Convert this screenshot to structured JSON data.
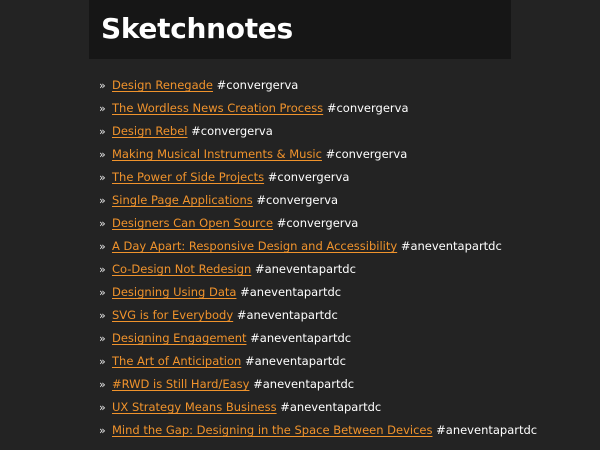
{
  "header": {
    "title": "Sketchnotes"
  },
  "items": [
    {
      "link": "Design Renegade",
      "tag": "#convergerva"
    },
    {
      "link": "The Wordless News Creation Process",
      "tag": "#convergerva"
    },
    {
      "link": "Design Rebel",
      "tag": "#convergerva"
    },
    {
      "link": "Making Musical Instruments & Music",
      "tag": "#convergerva"
    },
    {
      "link": "The Power of Side Projects",
      "tag": "#convergerva"
    },
    {
      "link": "Single Page Applications",
      "tag": "#convergerva"
    },
    {
      "link": "Designers Can Open Source",
      "tag": "#convergerva"
    },
    {
      "link": "A Day Apart: Responsive Design and Accessibility",
      "tag": "#aneventapartdc"
    },
    {
      "link": "Co-Design Not Redesign",
      "tag": "#aneventapartdc"
    },
    {
      "link": "Designing Using Data",
      "tag": "#aneventapartdc"
    },
    {
      "link": "SVG is for Everybody",
      "tag": "#aneventapartdc"
    },
    {
      "link": "Designing Engagement",
      "tag": "#aneventapartdc"
    },
    {
      "link": "The Art of Anticipation",
      "tag": "#aneventapartdc"
    },
    {
      "link": "#RWD is Still Hard/Easy",
      "tag": "#aneventapartdc"
    },
    {
      "link": "UX Strategy Means Business",
      "tag": "#aneventapartdc"
    },
    {
      "link": "Mind the Gap: Designing in the Space Between Devices",
      "tag": "#aneventapartdc"
    }
  ],
  "bullet": "»",
  "colors": {
    "background": "#232323",
    "header_background": "#161616",
    "link": "#f0932c",
    "text": "#ffffff"
  }
}
